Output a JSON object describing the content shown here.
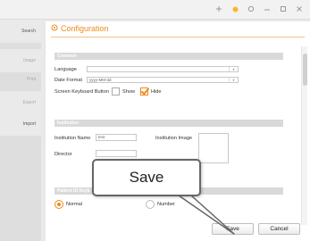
{
  "sidebar": {
    "items": [
      {
        "label": "Search"
      },
      {
        "label": "Image"
      },
      {
        "label": "Print"
      },
      {
        "label": "Export"
      },
      {
        "label": "Import"
      }
    ]
  },
  "panel": {
    "title": "Configuration",
    "common": {
      "header": "Common",
      "language_label": "Language",
      "language_value": "",
      "date_format_label": "Date Format",
      "date_format_value": "yyyy-MM-dd",
      "keyboard_label": "Screen Keyboard Button",
      "show_label": "Show",
      "hide_label": "Hide"
    },
    "institution": {
      "header": "Institution",
      "name_label": "Institution Name",
      "name_value": "test",
      "image_label": "Institution Image",
      "director_label": "Director"
    },
    "patient_id": {
      "header": "Patient ID Keyb",
      "normal_label": "Normal",
      "number_label": "Number"
    }
  },
  "footer": {
    "save_label": "Save",
    "cancel_label": "Cancel"
  },
  "callout": {
    "label": "Save"
  },
  "colors": {
    "accent": "#f08a1c"
  }
}
